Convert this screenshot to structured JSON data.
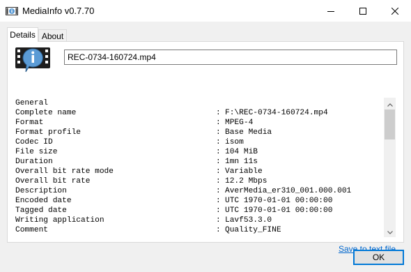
{
  "window": {
    "title": "MediaInfo v0.7.70",
    "icon": "mediainfo-app-icon",
    "controls": [
      "minimize-icon",
      "maximize-icon",
      "close-icon"
    ]
  },
  "tabs": [
    {
      "label": "Details",
      "active": true
    },
    {
      "label": "About",
      "active": false
    }
  ],
  "file": {
    "name": "REC-0734-160724.mp4",
    "icon": "media-info-icon"
  },
  "info": {
    "section": "General",
    "rows": [
      {
        "label": "Complete name",
        "value": "F:\\REC-0734-160724.mp4"
      },
      {
        "label": "Format",
        "value": "MPEG-4"
      },
      {
        "label": "Format profile",
        "value": "Base Media"
      },
      {
        "label": "Codec ID",
        "value": "isom"
      },
      {
        "label": "File size",
        "value": "104 MiB"
      },
      {
        "label": "Duration",
        "value": "1mn 11s"
      },
      {
        "label": "Overall bit rate mode",
        "value": "Variable"
      },
      {
        "label": "Overall bit rate",
        "value": "12.2 Mbps"
      },
      {
        "label": "Description",
        "value": "AverMedia_er310_001.000.001"
      },
      {
        "label": "Encoded date",
        "value": "UTC 1970-01-01 00:00:00"
      },
      {
        "label": "Tagged date",
        "value": "UTC 1970-01-01 00:00:00"
      },
      {
        "label": "Writing application",
        "value": "Lavf53.3.0"
      },
      {
        "label": "Comment",
        "value": "Quality_FINE"
      }
    ],
    "separator": ":"
  },
  "actions": {
    "save_link": "Save to text file",
    "ok_label": "OK"
  },
  "colors": {
    "link": "#0066cc",
    "focus_border": "#0078d7",
    "icon_blue": "#5b9bd5"
  }
}
